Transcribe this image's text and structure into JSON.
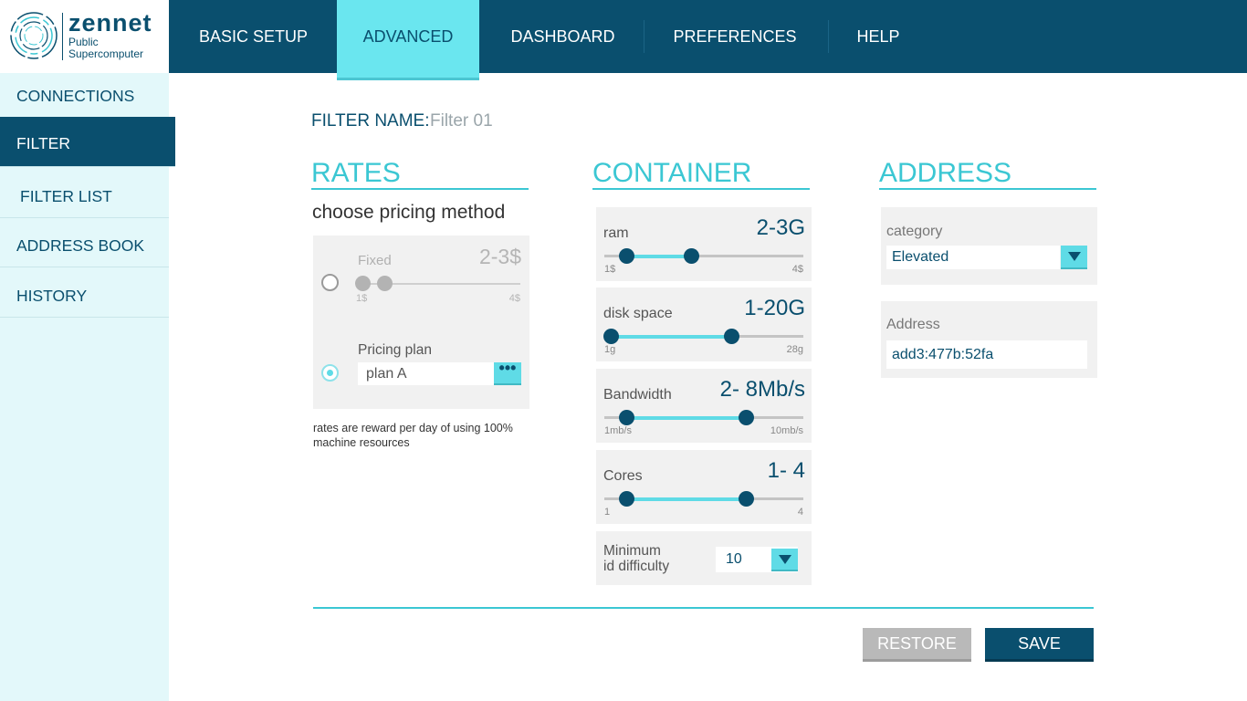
{
  "logo": {
    "title": "zennet",
    "subtitle_line1": "Public",
    "subtitle_line2": "Supercomputer"
  },
  "nav": {
    "tabs": [
      {
        "label": "BASIC SETUP"
      },
      {
        "label": "ADVANCED",
        "active": true
      },
      {
        "label": "DASHBOARD"
      },
      {
        "label": "PREFERENCES"
      },
      {
        "label": "HELP"
      }
    ]
  },
  "sidebar": {
    "items": [
      {
        "label": "CONNECTIONS"
      },
      {
        "label": "FILTER",
        "active": true
      },
      {
        "label": "FILTER LIST"
      },
      {
        "label": "ADDRESS BOOK"
      },
      {
        "label": "HISTORY"
      }
    ]
  },
  "filter": {
    "name_label": "FILTER NAME:",
    "name_value": "Filter 01"
  },
  "rates": {
    "title": "RATES",
    "subtitle": "choose pricing method",
    "fixed": {
      "label": "Fixed",
      "value": "2-3$",
      "min_label": "1$",
      "max_label": "4$",
      "selected": false
    },
    "plan": {
      "label": "Pricing plan",
      "value": "plan A",
      "button": "•••",
      "selected": true
    },
    "note": "rates are reward per day of using 100% machine resources"
  },
  "container": {
    "title": "CONTAINER",
    "ram": {
      "label": "ram",
      "value": "2-3G",
      "min_label": "1$",
      "max_label": "4$"
    },
    "disk": {
      "label": "disk space",
      "value": "1-20G",
      "min_label": "1g",
      "max_label": "28g"
    },
    "bandwidth": {
      "label": "Bandwidth",
      "value": "2- 8Mb/s",
      "min_label": "1mb/s",
      "max_label": "10mb/s"
    },
    "cores": {
      "label": "Cores",
      "value": "1- 4",
      "min_label": "1",
      "max_label": "4"
    },
    "difficulty": {
      "label_line1": "Minimum",
      "label_line2": "id difficulty",
      "value": "10"
    }
  },
  "address": {
    "title": "ADDRESS",
    "category": {
      "label": "category",
      "value": "Elevated"
    },
    "address": {
      "label": "Address",
      "value": "add3:477b:52fa"
    }
  },
  "actions": {
    "restore": "RESTORE",
    "save": "SAVE"
  },
  "colors": {
    "primary": "#0a4f6e",
    "accent": "#5fdbe6",
    "sidebar_bg": "#e3f8fa",
    "card_bg": "#f1f1f1"
  }
}
